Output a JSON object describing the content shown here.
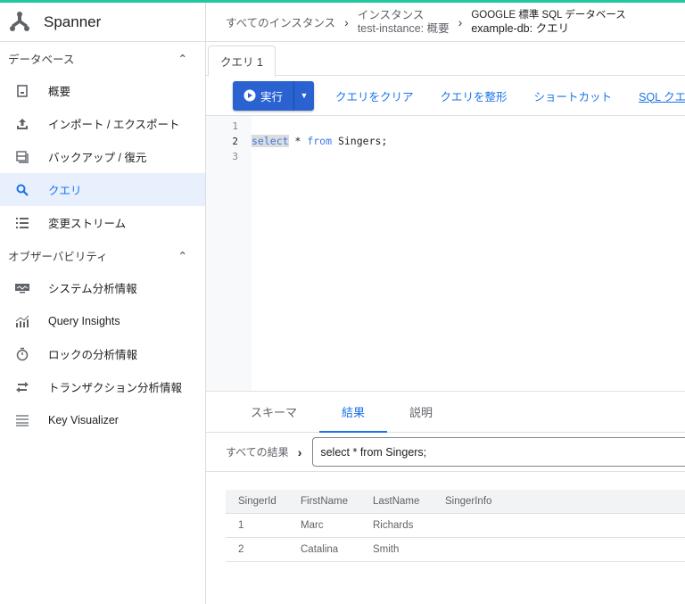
{
  "app": {
    "title": "Spanner",
    "accent": "#1ec8a0"
  },
  "breadcrumb": {
    "all_instances": "すべてのインスタンス",
    "instance_type": "インスタンス",
    "instance": "test-instance: 概要",
    "db_type": "GOOGLE 標準 SQL データベース",
    "db": "example-db: クエリ"
  },
  "sidebar": {
    "section_db": "データベース",
    "items": [
      {
        "label": "概要",
        "icon": "overview-icon"
      },
      {
        "label": "インポート / エクスポート",
        "icon": "upload-icon"
      },
      {
        "label": "バックアップ / 復元",
        "icon": "backup-icon"
      },
      {
        "label": "クエリ",
        "icon": "search-icon"
      },
      {
        "label": "変更ストリーム",
        "icon": "list-icon"
      }
    ],
    "section_obs": "オブザーバビリティ",
    "obs_items": [
      {
        "label": "システム分析情報",
        "icon": "monitor-icon"
      },
      {
        "label": "Query Insights",
        "icon": "insights-icon"
      },
      {
        "label": "ロックの分析情報",
        "icon": "timer-icon"
      },
      {
        "label": "トランザクション分析情報",
        "icon": "swap-icon"
      },
      {
        "label": "Key Visualizer",
        "icon": "grid-icon"
      }
    ]
  },
  "editor": {
    "tab": "クエリ 1",
    "run": "実行",
    "clear": "クエリをクリア",
    "format": "クエリを整形",
    "shortcuts": "ショートカット",
    "help": "SQL クエリのヘルプ",
    "lines": [
      "1",
      "2",
      "3"
    ],
    "kw_select": "select",
    "star": " * ",
    "kw_from": "from",
    "rest": " Singers;"
  },
  "results": {
    "tabs": [
      "スキーマ",
      "結果",
      "説明"
    ],
    "all_results": "すべての結果",
    "query": "select * from Singers;",
    "columns": [
      "SingerId",
      "FirstName",
      "LastName",
      "SingerInfo"
    ],
    "rows": [
      [
        "1",
        "Marc",
        "Richards",
        ""
      ],
      [
        "2",
        "Catalina",
        "Smith",
        ""
      ]
    ]
  }
}
